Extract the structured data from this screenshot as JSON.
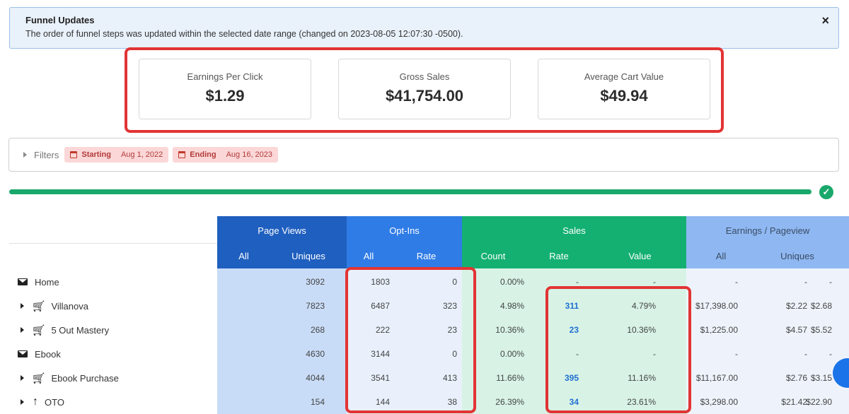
{
  "alert": {
    "title": "Funnel Updates",
    "text": "The order of funnel steps was updated within the selected date range (changed on 2023-08-05 12:07:30 -0500).",
    "close": "×"
  },
  "cards": [
    {
      "label": "Earnings Per Click",
      "value": "$1.29"
    },
    {
      "label": "Gross Sales",
      "value": "$41,754.00"
    },
    {
      "label": "Average Cart Value",
      "value": "$49.94"
    }
  ],
  "filters": {
    "label": "Filters",
    "starting_label": "Starting",
    "starting_value": "Aug 1, 2022",
    "ending_label": "Ending",
    "ending_value": "Aug 16, 2023"
  },
  "progress": {
    "value": 1.0,
    "status": "✓"
  },
  "colors": {
    "page_views": "#1f5fbf",
    "page_views_body": "#c9dcf7",
    "optins": "#2f7ce6",
    "optins_body": "#e9f0fb",
    "sales": "#14b072",
    "sales_body": "#d8f3e6",
    "earnings": "#8fb8f2",
    "earnings_body": "#eef3fb",
    "highlight": "#e23434"
  },
  "table": {
    "groups": {
      "page_views": "Page Views",
      "optins": "Opt-Ins",
      "sales": "Sales",
      "earnings": "Earnings / Pageview"
    },
    "subheaders": {
      "pv_all": "All",
      "pv_uniques": "Uniques",
      "oi_all": "All",
      "oi_rate": "Rate",
      "s_count": "Count",
      "s_rate": "Rate",
      "s_value": "Value",
      "e_all": "All",
      "e_uniques": "Uniques"
    },
    "rows": [
      {
        "icon": "envelope-icon",
        "expandable": false,
        "name": "Home",
        "pv_all": "3092",
        "pv_uniques": "1803",
        "oi_all": "0",
        "oi_rate": "0.00%",
        "s_count": "-",
        "s_rate": "-",
        "s_value": "-",
        "e_all": "-",
        "e_uniques": "-"
      },
      {
        "icon": "cart-icon",
        "expandable": true,
        "name": "Villanova",
        "pv_all": "7823",
        "pv_uniques": "6487",
        "oi_all": "323",
        "oi_rate": "4.98%",
        "s_count": "311",
        "s_rate": "4.79%",
        "s_value": "$17,398.00",
        "e_all": "$2.22",
        "e_uniques": "$2.68"
      },
      {
        "icon": "cart-icon",
        "expandable": true,
        "name": "5 Out Mastery",
        "pv_all": "268",
        "pv_uniques": "222",
        "oi_all": "23",
        "oi_rate": "10.36%",
        "s_count": "23",
        "s_rate": "10.36%",
        "s_value": "$1,225.00",
        "e_all": "$4.57",
        "e_uniques": "$5.52"
      },
      {
        "icon": "envelope-icon",
        "expandable": false,
        "name": "Ebook",
        "pv_all": "4630",
        "pv_uniques": "3144",
        "oi_all": "0",
        "oi_rate": "0.00%",
        "s_count": "-",
        "s_rate": "-",
        "s_value": "-",
        "e_all": "-",
        "e_uniques": "-"
      },
      {
        "icon": "cart-icon",
        "expandable": true,
        "name": "Ebook Purchase",
        "pv_all": "4044",
        "pv_uniques": "3541",
        "oi_all": "413",
        "oi_rate": "11.66%",
        "s_count": "395",
        "s_rate": "11.16%",
        "s_value": "$11,167.00",
        "e_all": "$2.76",
        "e_uniques": "$3.15"
      },
      {
        "icon": "arrow-up-icon",
        "expandable": true,
        "name": "OTO",
        "pv_all": "154",
        "pv_uniques": "144",
        "oi_all": "38",
        "oi_rate": "26.39%",
        "s_count": "34",
        "s_rate": "23.61%",
        "s_value": "$3,298.00",
        "e_all": "$21.42",
        "e_uniques": "$22.90"
      }
    ]
  }
}
